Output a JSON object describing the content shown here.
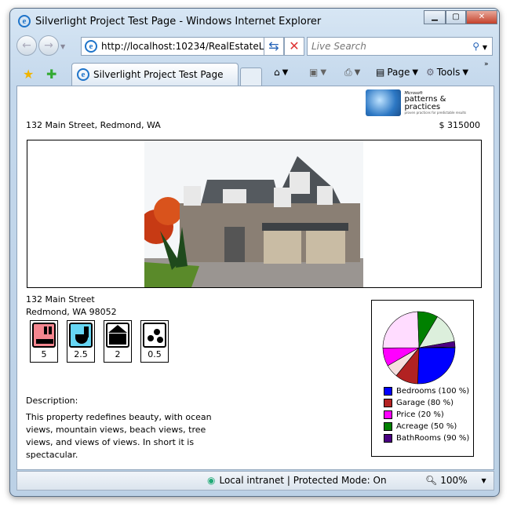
{
  "window": {
    "title": "Silverlight Project Test Page - Windows Internet Explorer"
  },
  "toolbar": {
    "address": "http://localhost:10234/RealEstateLis",
    "search_placeholder": "Live Search",
    "tab_label": "Silverlight Project Test Page",
    "page_label": "Page",
    "tools_label": "Tools"
  },
  "logo": {
    "small": "Microsoft",
    "main": "patterns & practices",
    "tag": "proven practices for predictable results"
  },
  "listing": {
    "heading_address": "132 Main Street, Redmond, WA",
    "price": "$ 315000",
    "street": "132 Main Street",
    "city": "Redmond, WA 98052",
    "features": [
      {
        "icon": "bedroom-icon",
        "value": "5"
      },
      {
        "icon": "bathroom-icon",
        "value": "2.5"
      },
      {
        "icon": "garage-icon",
        "value": "2"
      },
      {
        "icon": "acreage-icon",
        "value": "0.5"
      }
    ],
    "description_label": "Description:",
    "description": "This property redefines beauty, with ocean views, mountain views, beach views, tree views, and views of views.  In short it is spectacular."
  },
  "chart_data": {
    "type": "pie",
    "series": [
      {
        "name": "Bedrooms",
        "percent": 100,
        "label": "Bedrooms (100 %)",
        "color": "#0000ff"
      },
      {
        "name": "Garage",
        "percent": 80,
        "label": "Garage (80 %)",
        "color": "#b22222"
      },
      {
        "name": "Price",
        "percent": 20,
        "label": "Price (20 %)",
        "color": "#ff00ff"
      },
      {
        "name": "Acreage",
        "percent": 50,
        "label": "Acreage (50 %)",
        "color": "#008000"
      },
      {
        "name": "BathRooms",
        "percent": 90,
        "label": "BathRooms (90 %)",
        "color": "#4b0082"
      }
    ]
  },
  "status": {
    "zone": "Local intranet | Protected Mode: On",
    "zoom": "100%"
  }
}
